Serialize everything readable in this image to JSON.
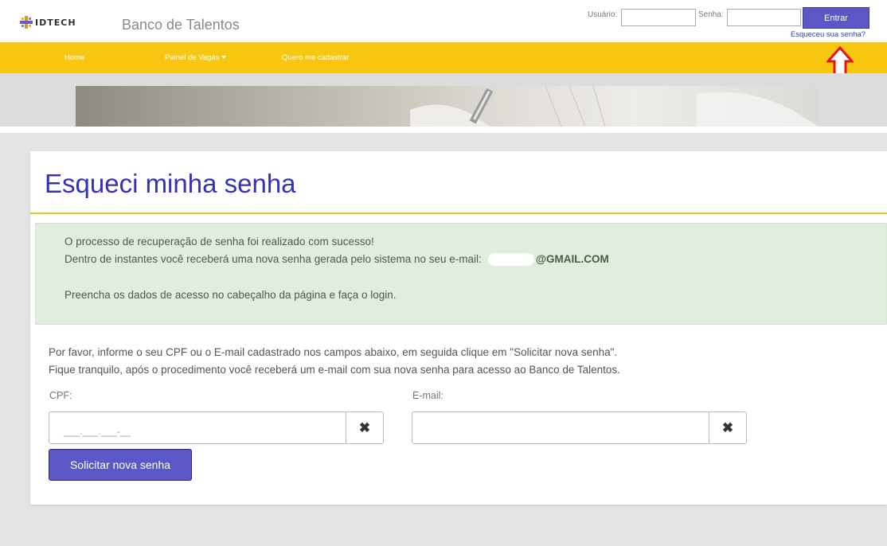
{
  "header": {
    "logo_text": "IDTECH",
    "site_title": "Banco de Talentos",
    "user_label": "Usuário:",
    "password_label": "Senha:",
    "login_button": "Entrar",
    "forgot_link": "Esqueceu sua senha?"
  },
  "nav": {
    "items": [
      {
        "label": "Home"
      },
      {
        "label": "Painel de Vagas"
      },
      {
        "label": "Quero me cadastrar"
      }
    ]
  },
  "colors": {
    "brand_purple": "#5a58c4",
    "nav_yellow": "#f6c611",
    "title_blue": "#3533b5",
    "alert_green": "#e0eedd",
    "annotation_red": "#e8141b"
  },
  "main": {
    "title": "Esqueci minha senha",
    "alert": {
      "line1": "O processo de recuperação de senha foi realizado com sucesso!",
      "line2": "Dentro de instantes você receberá uma nova senha gerada pelo sistema no seu e-mail:",
      "email_domain": "@GMAIL.COM",
      "line3": "Preencha os dados de acesso no cabeçalho da página e faça o login."
    },
    "instructions": {
      "line1": "Por favor, informe o seu CPF ou o E-mail cadastrado nos campos abaixo, em seguida clique em \"Solicitar nova senha\".",
      "line2": "Fique tranquilo, após o procedimento você receberá um e-mail com sua nova senha para acesso ao Banco de Talentos."
    },
    "form": {
      "cpf_label": "CPF:",
      "cpf_mask": "___.___.___-__",
      "email_label": "E-mail:",
      "clear_icon": "close-icon",
      "submit_button": "Solicitar nova senha"
    }
  }
}
